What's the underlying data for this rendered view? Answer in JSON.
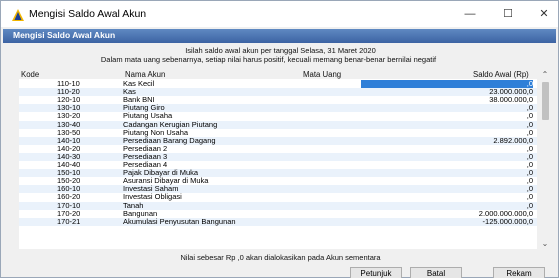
{
  "window": {
    "title": "Mengisi Saldo Awal Akun",
    "min_glyph": "—",
    "max_glyph": "☐",
    "close_glyph": "✕"
  },
  "header": {
    "label": "Mengisi Saldo Awal Akun"
  },
  "info": {
    "line1": "Isilah saldo awal akun per tanggal Selasa, 31 Maret 2020",
    "line2": "Dalam mata uang sebenarnya, setiap nilai harus positif, kecuali memang benar-benar bernilai negatif"
  },
  "columns": {
    "kode": "Kode",
    "nama": "Nama Akun",
    "mata": "Mata Uang",
    "saldo": "Saldo Awal (Rp)"
  },
  "rows": [
    {
      "kode": "110-10",
      "nama": "Kas Kecil",
      "saldo": ",0"
    },
    {
      "kode": "110-20",
      "nama": "Kas",
      "saldo": "23.000.000,0"
    },
    {
      "kode": "120-10",
      "nama": "Bank BNI",
      "saldo": "38.000.000,0"
    },
    {
      "kode": "130-10",
      "nama": "Piutang Giro",
      "saldo": ",0"
    },
    {
      "kode": "130-20",
      "nama": "Piutang Usaha",
      "saldo": ",0"
    },
    {
      "kode": "130-40",
      "nama": "Cadangan Kerugian Piutang",
      "saldo": ",0"
    },
    {
      "kode": "130-50",
      "nama": "Piutang Non Usaha",
      "saldo": ",0"
    },
    {
      "kode": "140-10",
      "nama": "Persediaan Barang Dagang",
      "saldo": "2.892.000,0"
    },
    {
      "kode": "140-20",
      "nama": "Persediaan 2",
      "saldo": ",0"
    },
    {
      "kode": "140-30",
      "nama": "Persediaan 3",
      "saldo": ",0"
    },
    {
      "kode": "140-40",
      "nama": "Persediaan 4",
      "saldo": ",0"
    },
    {
      "kode": "150-10",
      "nama": "Pajak Dibayar di Muka",
      "saldo": ",0"
    },
    {
      "kode": "150-20",
      "nama": "Asuransi Dibayar di Muka",
      "saldo": ",0"
    },
    {
      "kode": "160-10",
      "nama": "Investasi Saham",
      "saldo": ",0"
    },
    {
      "kode": "160-20",
      "nama": "Investasi Obligasi",
      "saldo": ",0"
    },
    {
      "kode": "170-10",
      "nama": "Tanah",
      "saldo": ",0"
    },
    {
      "kode": "170-20",
      "nama": "Bangunan",
      "saldo": "2.000.000.000,0"
    },
    {
      "kode": "170-21",
      "nama": "Akumulasi Penyusutan Bangunan",
      "saldo": "-125.000.000,0"
    }
  ],
  "footer": {
    "note": "Nilai sebesar Rp ,0 akan dialokasikan pada Akun sementara"
  },
  "buttons": {
    "petunjuk": "Petunjuk",
    "batal": "Batal",
    "rekam": "Rekam"
  },
  "scrollbar": {
    "up": "⌃",
    "down": "⌄"
  }
}
